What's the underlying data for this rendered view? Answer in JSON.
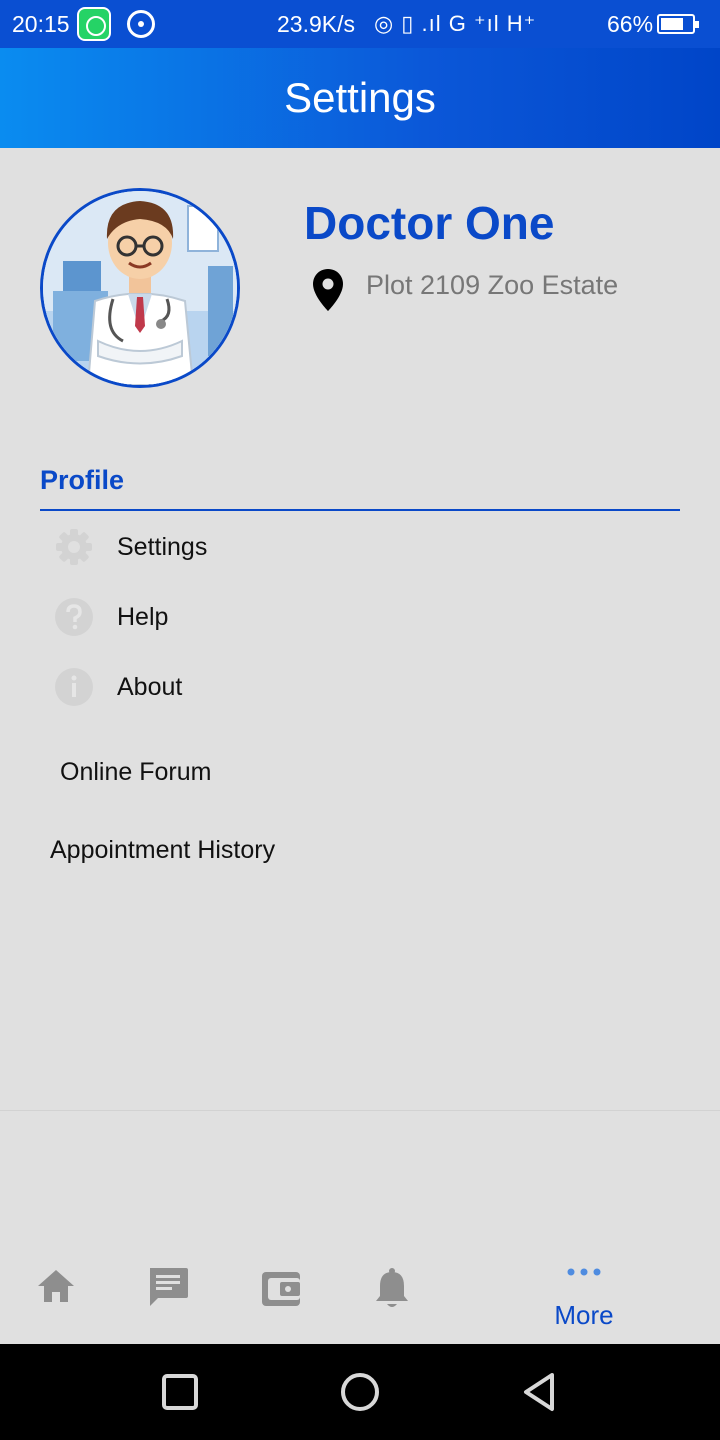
{
  "status_bar": {
    "time": "20:15",
    "net_speed": "23.9K/s",
    "signal_text": "◎ ▯ .ıl G ⁺ıl H⁺",
    "battery": "66%",
    "battery_level": 0.66
  },
  "app_bar": {
    "title": "Settings"
  },
  "profile": {
    "name": "Doctor One",
    "address": "Plot 2109 Zoo Estate"
  },
  "section": {
    "title": "Profile"
  },
  "menu": [
    {
      "label": "Settings",
      "icon": "gear-icon"
    },
    {
      "label": "Help",
      "icon": "help-icon"
    },
    {
      "label": "About",
      "icon": "info-icon"
    }
  ],
  "links": {
    "online_forum": "Online Forum",
    "appointment_history": "Appointment History"
  },
  "bottom_nav": {
    "items": [
      "home-icon",
      "chat-icon",
      "wallet-icon",
      "bell-icon",
      "more-icon"
    ],
    "more_label": "More",
    "active": "More"
  },
  "colors": {
    "primary": "#0a49c8",
    "app_bar_start": "#0a8cf0",
    "app_bar_end": "#0045c8",
    "background": "#e0e0e0",
    "inactive_icon": "#8e8e8e"
  }
}
